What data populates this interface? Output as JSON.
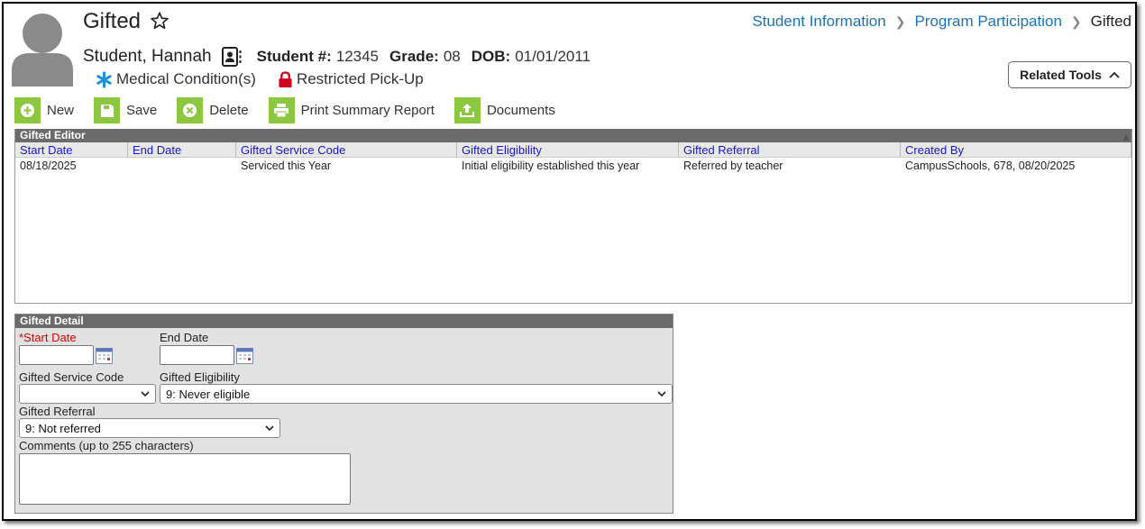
{
  "header": {
    "title": "Gifted",
    "breadcrumb": [
      "Student Information",
      "Program Participation",
      "Gifted"
    ]
  },
  "student": {
    "name": "Student, Hannah",
    "number_label": "Student #:",
    "number": "12345",
    "grade_label": "Grade:",
    "grade": "08",
    "dob_label": "DOB:",
    "dob": "01/01/2011"
  },
  "flags": {
    "medical": "Medical Condition(s)",
    "pickup": "Restricted Pick-Up"
  },
  "related_tools": "Related Tools",
  "toolbar": {
    "new": "New",
    "save": "Save",
    "delete": "Delete",
    "print": "Print Summary Report",
    "documents": "Documents"
  },
  "editor": {
    "title": "Gifted Editor",
    "columns": [
      "Start Date",
      "End Date",
      "Gifted Service Code",
      "Gifted Eligibility",
      "Gifted Referral",
      "Created By"
    ],
    "rows": [
      [
        "08/18/2025",
        "",
        "Serviced this Year",
        "Initial eligibility established this year",
        "Referred by teacher",
        "CampusSchools, 678, 08/20/2025"
      ]
    ]
  },
  "detail": {
    "title": "Gifted Detail",
    "start_date_label": "*Start Date",
    "start_date_value": "",
    "end_date_label": "End Date",
    "end_date_value": "",
    "service_code_label": "Gifted Service Code",
    "service_code_value": "",
    "eligibility_label": "Gifted Eligibility",
    "eligibility_value": "9: Never eligible",
    "referral_label": "Gifted Referral",
    "referral_value": "9: Not referred",
    "comments_label": "Comments (up to 255 characters)",
    "comments_value": ""
  },
  "colors": {
    "link": "#1a73b8",
    "toolbar_icon_bg": "#8dc63f",
    "header_bar": "#6b6b6b",
    "column_header_text": "#1616d4",
    "required": "#dd0000",
    "medical_icon": "#1e90d6",
    "pickup_icon": "#d0021b"
  }
}
